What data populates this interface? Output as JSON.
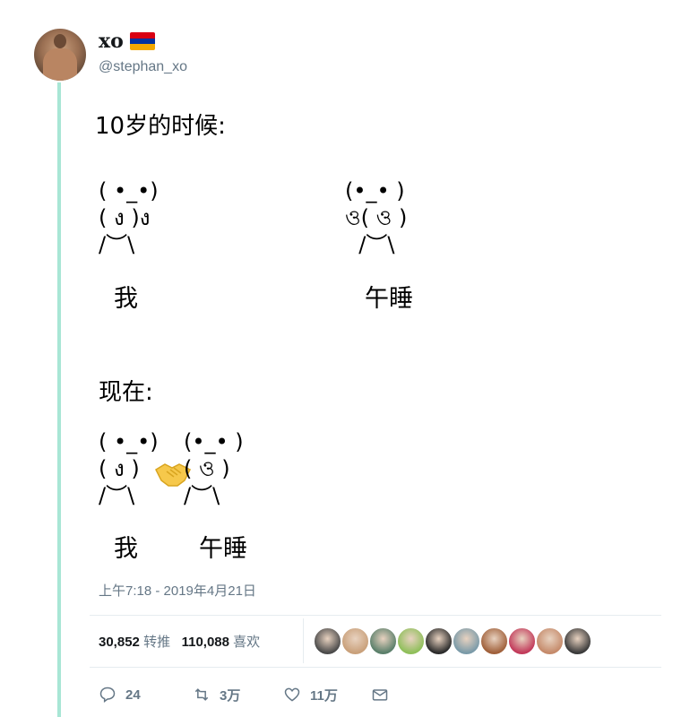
{
  "author": {
    "display_name": "xo",
    "handle": "@stephan_xo",
    "flag": {
      "name": "armenia-flag",
      "colors": [
        "#d90012",
        "#0033a0",
        "#f2a800"
      ]
    }
  },
  "tweet": {
    "section1_heading": "10岁的时候:",
    "section1_left_face": "( •_•)\n( ง )ง\n/︶\\",
    "section1_left_caption": "我",
    "section1_right_face": "(•_• )\nও( ও )\n  /︶\\",
    "section1_right_caption": "午睡",
    "section2_heading": "现在:",
    "section2_left_face": "( •_•)\n( ง )\n/︶\\",
    "section2_left_caption": "我",
    "section2_right_face": "(•_• )\n( ও )\n/︶\\",
    "section2_right_caption": "午睡",
    "handshake_icon": "handshake-icon"
  },
  "timestamp": "上午7:18 - 2019年4月21日",
  "stats": {
    "retweets_count": "30,852",
    "retweets_label": "转推",
    "likes_count": "110,088",
    "likes_label": "喜欢"
  },
  "likers": [
    {
      "name": "liker-avatar-1",
      "color": "#4a4a4a"
    },
    {
      "name": "liker-avatar-2",
      "color": "#c9a07a"
    },
    {
      "name": "liker-avatar-3",
      "color": "#5a7f6a"
    },
    {
      "name": "liker-avatar-4",
      "color": "#8fbf5a"
    },
    {
      "name": "liker-avatar-5",
      "color": "#2b2b2b"
    },
    {
      "name": "liker-avatar-6",
      "color": "#7a9aa8"
    },
    {
      "name": "liker-avatar-7",
      "color": "#a0603a"
    },
    {
      "name": "liker-avatar-8",
      "color": "#c23a5a"
    },
    {
      "name": "liker-avatar-9",
      "color": "#c58a6a"
    },
    {
      "name": "liker-avatar-10",
      "color": "#3a3a3a"
    }
  ],
  "actions": {
    "reply_count": "24",
    "retweet_count": "3万",
    "like_count": "11万"
  }
}
